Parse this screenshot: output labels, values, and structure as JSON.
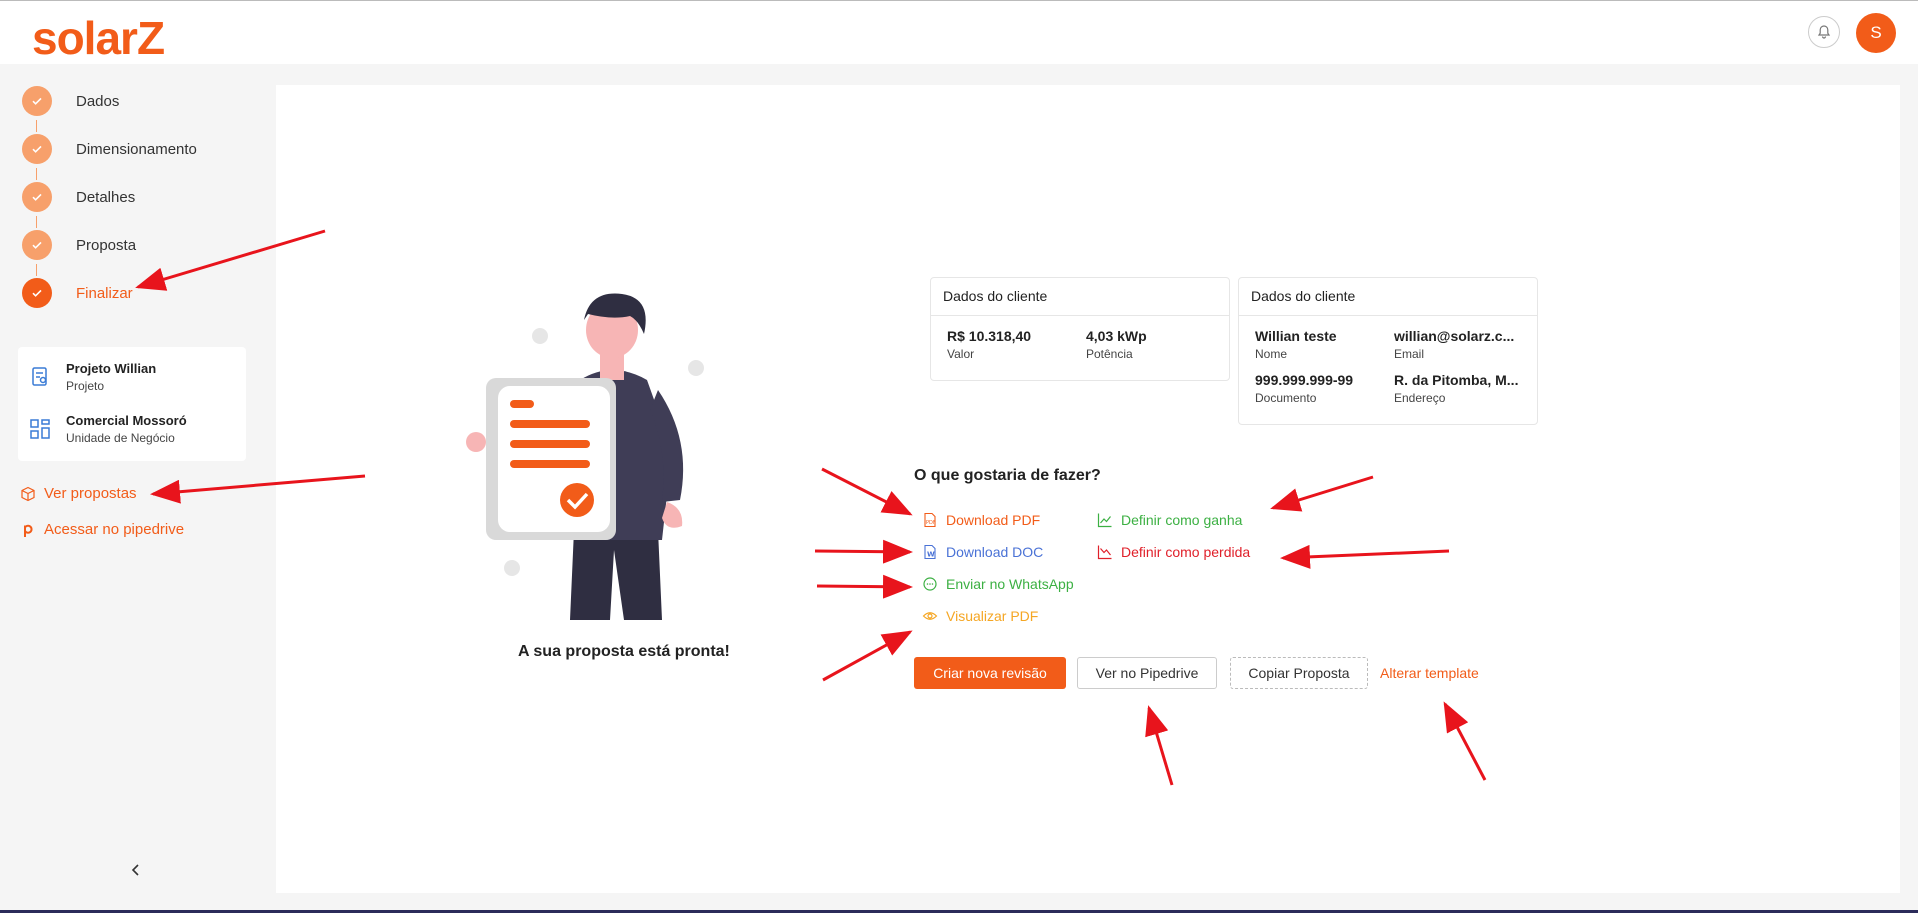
{
  "app": {
    "logo": "solarZ",
    "user_initial": "S",
    "accent_color": "#f25c19"
  },
  "steps": [
    {
      "label": "Dados",
      "status": "done"
    },
    {
      "label": "Dimensionamento",
      "status": "done"
    },
    {
      "label": "Detalhes",
      "status": "done"
    },
    {
      "label": "Proposta",
      "status": "done"
    },
    {
      "label": "Finalizar",
      "status": "active"
    }
  ],
  "project": {
    "name": "Projeto Willian",
    "name_label": "Projeto",
    "unit": "Comercial Mossoró",
    "unit_label": "Unidade de Negócio"
  },
  "links": {
    "proposals": "Ver propostas",
    "pipedrive": "Acessar no pipedrive"
  },
  "ready_text": "A sua proposta está pronta!",
  "card_proposal": {
    "title": "Dados do cliente",
    "value": "R$ 10.318,40",
    "value_label": "Valor",
    "power": "4,03 kWp",
    "power_label": "Potência"
  },
  "card_client": {
    "title": "Dados do cliente",
    "name": "Willian teste",
    "name_label": "Nome",
    "email": "willian@solarz.c...",
    "email_label": "Email",
    "document": "999.999.999-99",
    "document_label": "Documento",
    "address": "R. da Pitomba, M...",
    "address_label": "Endereço"
  },
  "question": "O que gostaria de fazer?",
  "actions": {
    "download_pdf": "Download PDF",
    "download_doc": "Download DOC",
    "whatsapp": "Enviar no WhatsApp",
    "view_pdf": "Visualizar PDF",
    "set_won": "Definir como ganha",
    "set_lost": "Definir como perdida"
  },
  "buttons": {
    "new_revision": "Criar nova revisão",
    "view_pipedrive": "Ver no Pipedrive",
    "copy_proposal": "Copiar Proposta",
    "change_template": "Alterar template"
  },
  "colors": {
    "pdf": "#f25c19",
    "doc": "#4a72d6",
    "whatsapp": "#3cb043",
    "view": "#f5a623",
    "won": "#3cb043",
    "lost": "#e0202a"
  }
}
